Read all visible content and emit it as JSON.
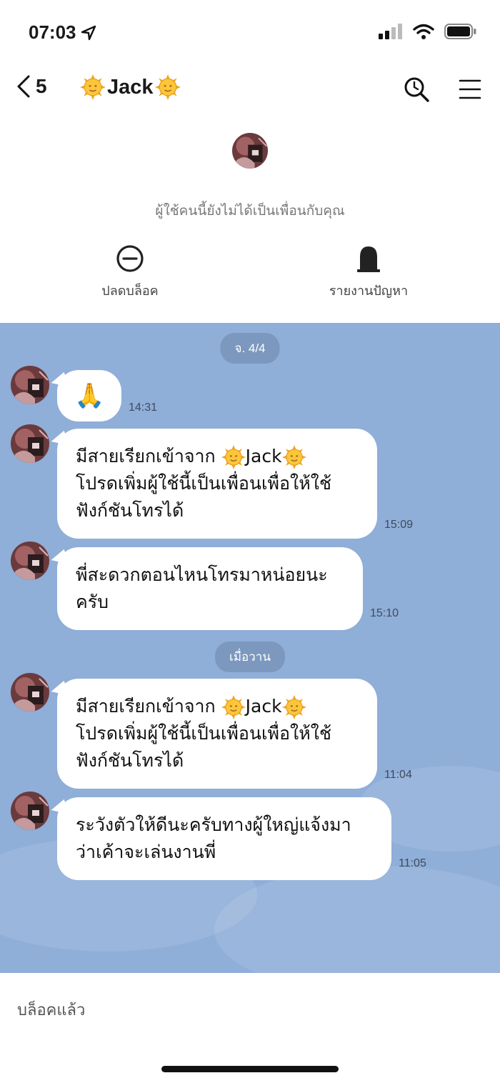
{
  "status_bar": {
    "time": "07:03",
    "location_icon": "location-arrow-icon",
    "signal_icon": "cellular-signal-icon",
    "wifi_icon": "wifi-icon",
    "battery_icon": "battery-icon"
  },
  "nav": {
    "back_count": "5",
    "back_icon": "chevron-left-icon",
    "title": "Jack",
    "title_emoji": "sun-with-face",
    "search_icon": "search-icon",
    "menu_icon": "menu-icon"
  },
  "profile": {
    "notice": "ผู้ใช้คนนี้ยังไม่ได้เป็นเพื่อนกับคุณ",
    "unblock_label": "ปลดบล็อค",
    "report_label": "รายงานปัญหา",
    "unblock_icon": "minus-circle-icon",
    "report_icon": "tombstone-icon"
  },
  "chat": {
    "date_1": "จ. 4/4",
    "date_2": "เมื่อวาน",
    "messages": [
      {
        "type": "emoji",
        "text": "🙏",
        "time": "14:31"
      },
      {
        "type": "text",
        "line_1_prefix": "มีสายเรียกเข้าจาก",
        "line_1_name": "Jack",
        "line_2": "โปรดเพิ่มผู้ใช้นี้เป็นเพื่อนเพื่อให้ใช้",
        "line_3": "ฟังก์ชันโทรได้",
        "time": "15:09"
      },
      {
        "type": "text",
        "line_1": "พี่สะดวกตอนไหนโทรมาหน่อยนะ",
        "line_2": "ครับ",
        "time": "15:10"
      },
      {
        "type": "text",
        "line_1_prefix": "มีสายเรียกเข้าจาก",
        "line_1_name": "Jack",
        "line_2": "โปรดเพิ่มผู้ใช้นี้เป็นเพื่อนเพื่อให้ใช้",
        "line_3": "ฟังก์ชันโทรได้",
        "time": "11:04"
      },
      {
        "type": "text",
        "line_1": "ระวังตัวให้ดีนะครับทางผู้ใหญ่แจ้งมา",
        "line_2": "ว่าเค้าจะเล่นงานพี่",
        "time": "11:05"
      }
    ]
  },
  "footer": {
    "blocked_label": "บล็อคแล้ว"
  },
  "colors": {
    "chat_background": "#8faed8",
    "bubble": "#ffffff",
    "date_pill": "#6e87aa"
  }
}
